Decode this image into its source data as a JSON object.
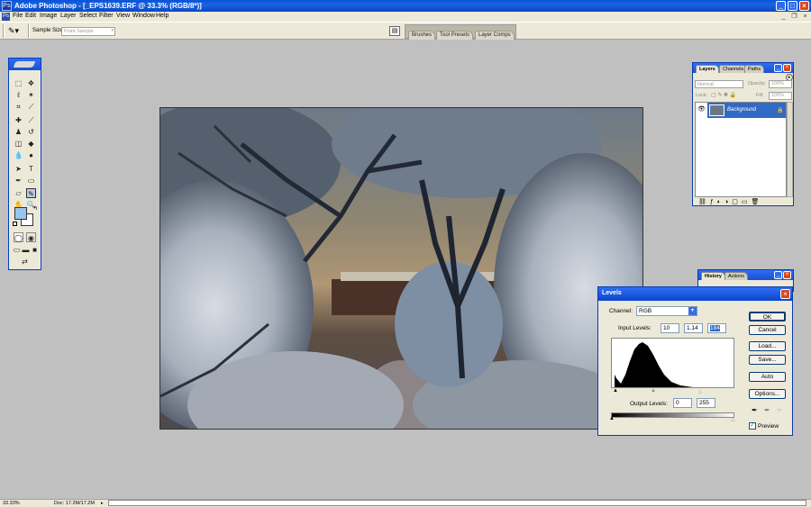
{
  "window": {
    "title": "Adobe Photoshop - [_EPS1639.ERF @ 33.3% (RGB/8*)]"
  },
  "menu": [
    "File",
    "Edit",
    "Image",
    "Layer",
    "Select",
    "Filter",
    "View",
    "Window",
    "Help"
  ],
  "options_bar": {
    "sample_size_label": "Sample Size:",
    "sample_size_value": "Point Sample"
  },
  "palette_well": {
    "tabs": [
      "Brushes",
      "Tool Presets",
      "Layer Comps"
    ]
  },
  "layers_palette": {
    "tabs": [
      "Layers",
      "Channels",
      "Paths"
    ],
    "blend_mode": "Normal",
    "opacity_label": "Opacity:",
    "opacity_value": "100%",
    "lock_label": "Lock:",
    "fill_label": "Fill:",
    "fill_value": "100%",
    "layer_name": "Background"
  },
  "history_palette": {
    "tabs": [
      "History",
      "Actions"
    ]
  },
  "levels": {
    "title": "Levels",
    "channel_label": "Channel:",
    "channel_value": "RGB",
    "input_label": "Input Levels:",
    "input_black": "10",
    "input_gamma": "1.14",
    "input_white": "184",
    "output_label": "Output Levels:",
    "output_black": "0",
    "output_white": "255",
    "buttons": {
      "ok": "OK",
      "cancel": "Cancel",
      "load": "Load...",
      "save": "Save...",
      "auto": "Auto",
      "options": "Options..."
    },
    "preview_label": "Preview",
    "preview_checked": true
  },
  "status": {
    "zoom": "33.33%",
    "doc": "Doc: 17.2M/17.2M"
  },
  "colors": {
    "foreground": "#98c4f0",
    "background": "#ffffff",
    "titlebar": "#0a54d8",
    "chrome": "#ece9d8"
  }
}
